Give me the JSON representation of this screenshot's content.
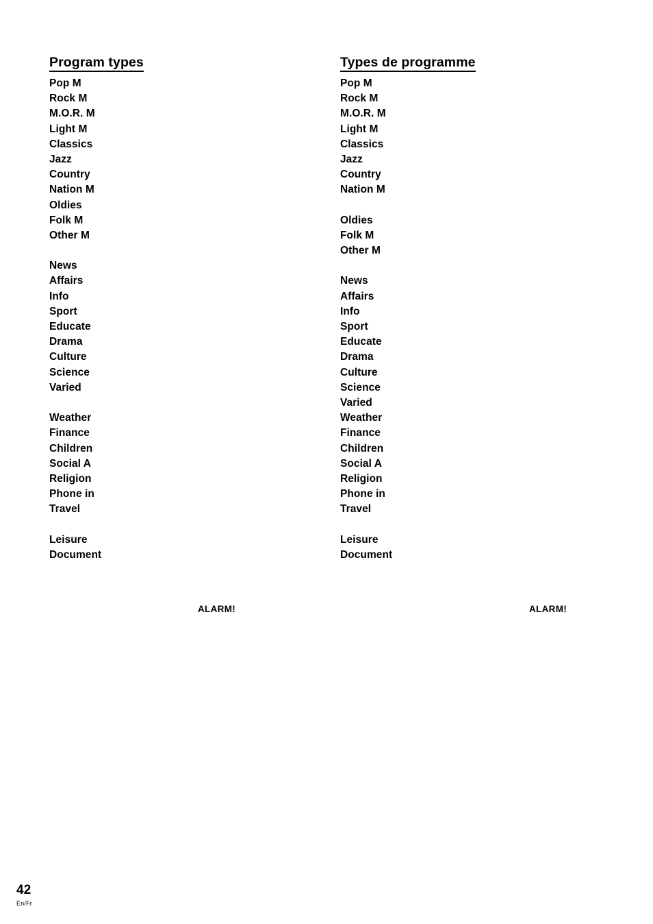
{
  "page": {
    "number": "42",
    "language_code": "En/Fr"
  },
  "columns": {
    "english": {
      "heading": "Program types",
      "items": [
        "Pop M",
        "Rock M",
        "M.O.R. M",
        "Light M",
        "Classics",
        "Jazz",
        "Country",
        "Nation M",
        "Oldies",
        "Folk M",
        "Other M",
        "",
        "News",
        "Affairs",
        "Info",
        "Sport",
        "Educate",
        "Drama",
        "Culture",
        "Science",
        "Varied",
        "",
        "Weather",
        "Finance",
        "Children",
        "Social A",
        "Religion",
        "Phone in",
        "Travel",
        "",
        "Leisure",
        "Document"
      ],
      "alarm_label": "ALARM!"
    },
    "french": {
      "heading": "Types de programme",
      "items": [
        "Pop M",
        "Rock M",
        "M.O.R. M",
        "Light M",
        "Classics",
        "Jazz",
        "Country",
        "Nation M",
        "",
        "Oldies",
        "Folk M",
        "Other M",
        "",
        "News",
        "Affairs",
        "Info",
        "Sport",
        "Educate",
        "Drama",
        "Culture",
        "Science",
        "Varied",
        "Weather",
        "Finance",
        "Children",
        "Social A",
        "Religion",
        "Phone in",
        "Travel",
        "",
        "Leisure",
        "Document"
      ],
      "alarm_label": "ALARM!"
    }
  }
}
